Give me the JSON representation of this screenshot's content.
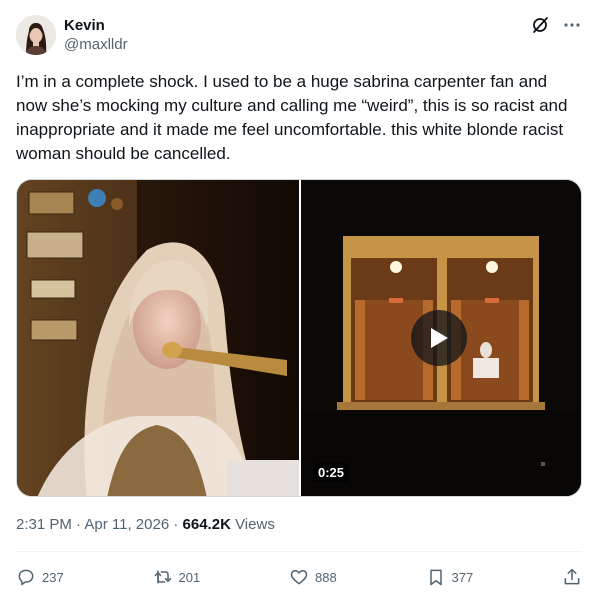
{
  "author": {
    "display_name": "Kevin",
    "handle": "@maxlldr"
  },
  "tweet": {
    "text": "I’m in a complete shock. I used to be a huge sabrina carpenter fan and now she’s mocking my culture and calling me “weird”, this is so racist and inappropriate and it made me feel uncomfortable. this white blonde racist woman should be cancelled."
  },
  "media": {
    "video_duration": "0:25"
  },
  "meta": {
    "time": "2:31 PM",
    "separator1": " · ",
    "date": "Apr 11, 2026",
    "separator2": " · ",
    "views_count": "664.2K",
    "views_label": " Views"
  },
  "actions": {
    "replies": "237",
    "reposts": "201",
    "likes": "888",
    "bookmarks": "377"
  },
  "icons": {
    "grok": "grok-icon",
    "more": "more-icon",
    "reply": "reply-icon",
    "repost": "repost-icon",
    "like": "heart-icon",
    "bookmark": "bookmark-icon",
    "share": "share-icon",
    "play": "play-icon"
  },
  "colors": {
    "text": "#0f1419",
    "secondary": "#536471",
    "border": "#cfd9de"
  }
}
